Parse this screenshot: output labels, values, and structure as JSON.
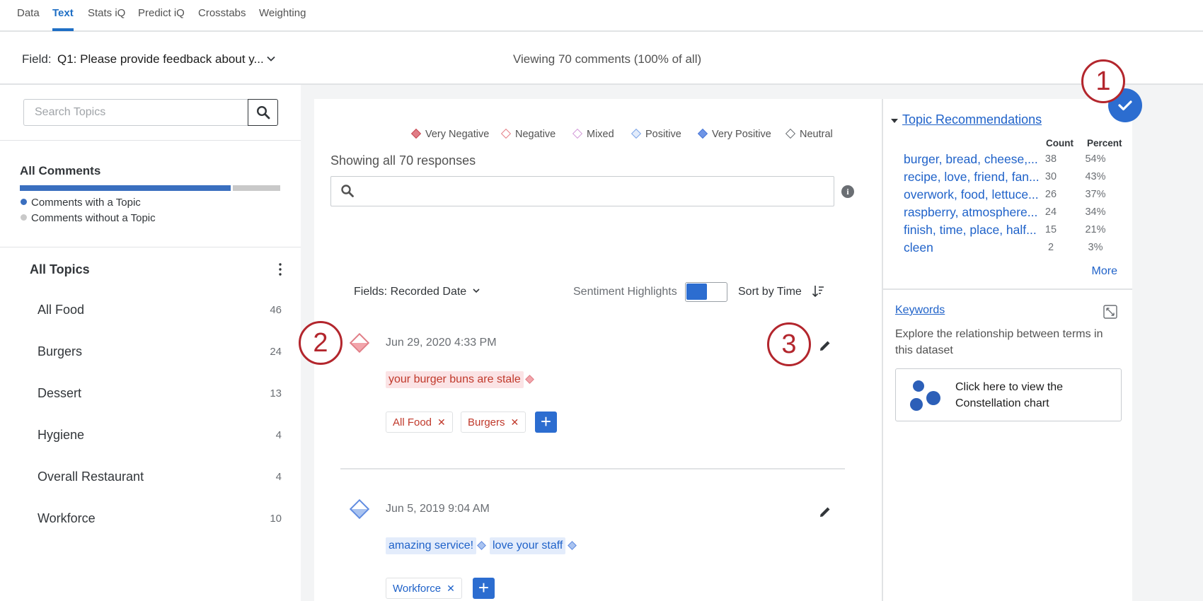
{
  "nav": {
    "tabs": [
      {
        "label": "Data",
        "active": false
      },
      {
        "label": "Text",
        "active": true
      },
      {
        "label": "Stats iQ",
        "active": false
      },
      {
        "label": "Predict iQ",
        "active": false
      },
      {
        "label": "Crosstabs",
        "active": false
      },
      {
        "label": "Weighting",
        "active": false
      }
    ]
  },
  "field_bar": {
    "label": "Field:",
    "value": "Q1: Please provide feedback about y...",
    "viewing": "Viewing 70 comments (100% of all)"
  },
  "left": {
    "search_placeholder": "Search Topics",
    "all_comments": "All Comments",
    "with_topic_fraction": 0.81,
    "legend": {
      "with_topic": "Comments with a Topic",
      "without_topic": "Comments without a Topic"
    },
    "all_topics": "All Topics",
    "topics": [
      {
        "name": "All Food",
        "count": "46"
      },
      {
        "name": "Burgers",
        "count": "24"
      },
      {
        "name": "Dessert",
        "count": "13"
      },
      {
        "name": "Hygiene",
        "count": "4"
      },
      {
        "name": "Overall Restaurant",
        "count": "4"
      },
      {
        "name": "Workforce",
        "count": "10"
      }
    ]
  },
  "center": {
    "sentiment_legend": [
      {
        "label": "Very Negative",
        "color": "#e07d86"
      },
      {
        "label": "Negative",
        "color": "#e58088"
      },
      {
        "label": "Mixed",
        "color": "#d39ad9"
      },
      {
        "label": "Positive",
        "color": "#7ea6e8"
      },
      {
        "label": "Very Positive",
        "color": "#6f95e6"
      },
      {
        "label": "Neutral",
        "color": "#6a6e73"
      }
    ],
    "showing": "Showing all 70 responses",
    "fields_dropdown": "Fields: Recorded Date",
    "sentiment_highlights": "Sentiment Highlights",
    "sort_by": "Sort by Time",
    "responses": [
      {
        "date": "Jun 29, 2020 4:33 PM",
        "sentiment": "negative",
        "highlights": [
          "your burger buns are stale"
        ],
        "tags": [
          "All Food",
          "Burgers"
        ]
      },
      {
        "date": "Jun 5, 2019 9:04 AM",
        "sentiment": "positive",
        "highlights": [
          "amazing service!",
          "love your staff"
        ],
        "tags": [
          "Workforce"
        ]
      }
    ]
  },
  "right": {
    "topic_recommendations": "Topic Recommendations",
    "col_count": "Count",
    "col_percent": "Percent",
    "recommendations": [
      {
        "topic": "burger, bread, cheese,...",
        "count": "38",
        "percent": "54%"
      },
      {
        "topic": "recipe, love, friend, fan...",
        "count": "30",
        "percent": "43%"
      },
      {
        "topic": "overwork, food, lettuce...",
        "count": "26",
        "percent": "37%"
      },
      {
        "topic": "raspberry, atmosphere...",
        "count": "24",
        "percent": "34%"
      },
      {
        "topic": "finish, time, place, half...",
        "count": "15",
        "percent": "21%"
      },
      {
        "topic": "cleen",
        "count": "2",
        "percent": "3%"
      }
    ],
    "more": "More",
    "keywords": "Keywords",
    "keywords_desc": "Explore the relationship between terms in this dataset",
    "constellation": "Click here to view the Constellation chart"
  },
  "callouts": [
    "1",
    "2",
    "3"
  ],
  "colors": {
    "accent": "#2c6dd0",
    "link": "#1f62c9",
    "negative": "#c0392b",
    "callout": "#b3262d"
  }
}
